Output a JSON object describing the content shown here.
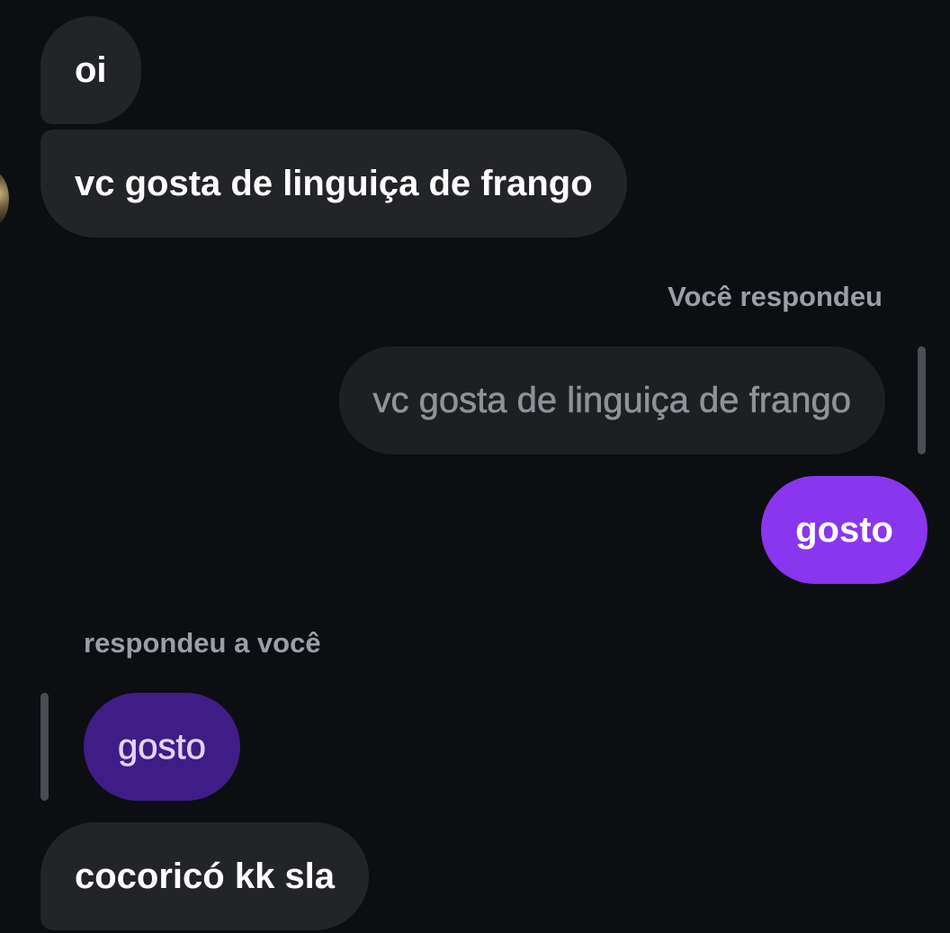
{
  "messages": [
    {
      "id": "m1",
      "direction": "received",
      "text": "oi"
    },
    {
      "id": "m2",
      "direction": "received",
      "text": "vc gosta de linguiça de frango"
    },
    {
      "id": "m3",
      "direction": "sent",
      "reply_label": "Você respondeu",
      "quoted_text": "vc gosta de linguiça de frango",
      "text": "gosto"
    },
    {
      "id": "m4",
      "direction": "received",
      "reply_label": "respondeu a você",
      "quoted_text": "gosto",
      "text": "cocoricó kk sla"
    }
  ],
  "colors": {
    "background": "#0c0e12",
    "received_bubble": "#222428",
    "sent_bubble": "#8a35ee",
    "quoted_self_bubble": "#1d1f23",
    "quoted_other_bubble": "#3f1d86",
    "label_text": "#9a9ea6"
  },
  "icons": {
    "avatar": "contact-avatar-icon"
  }
}
